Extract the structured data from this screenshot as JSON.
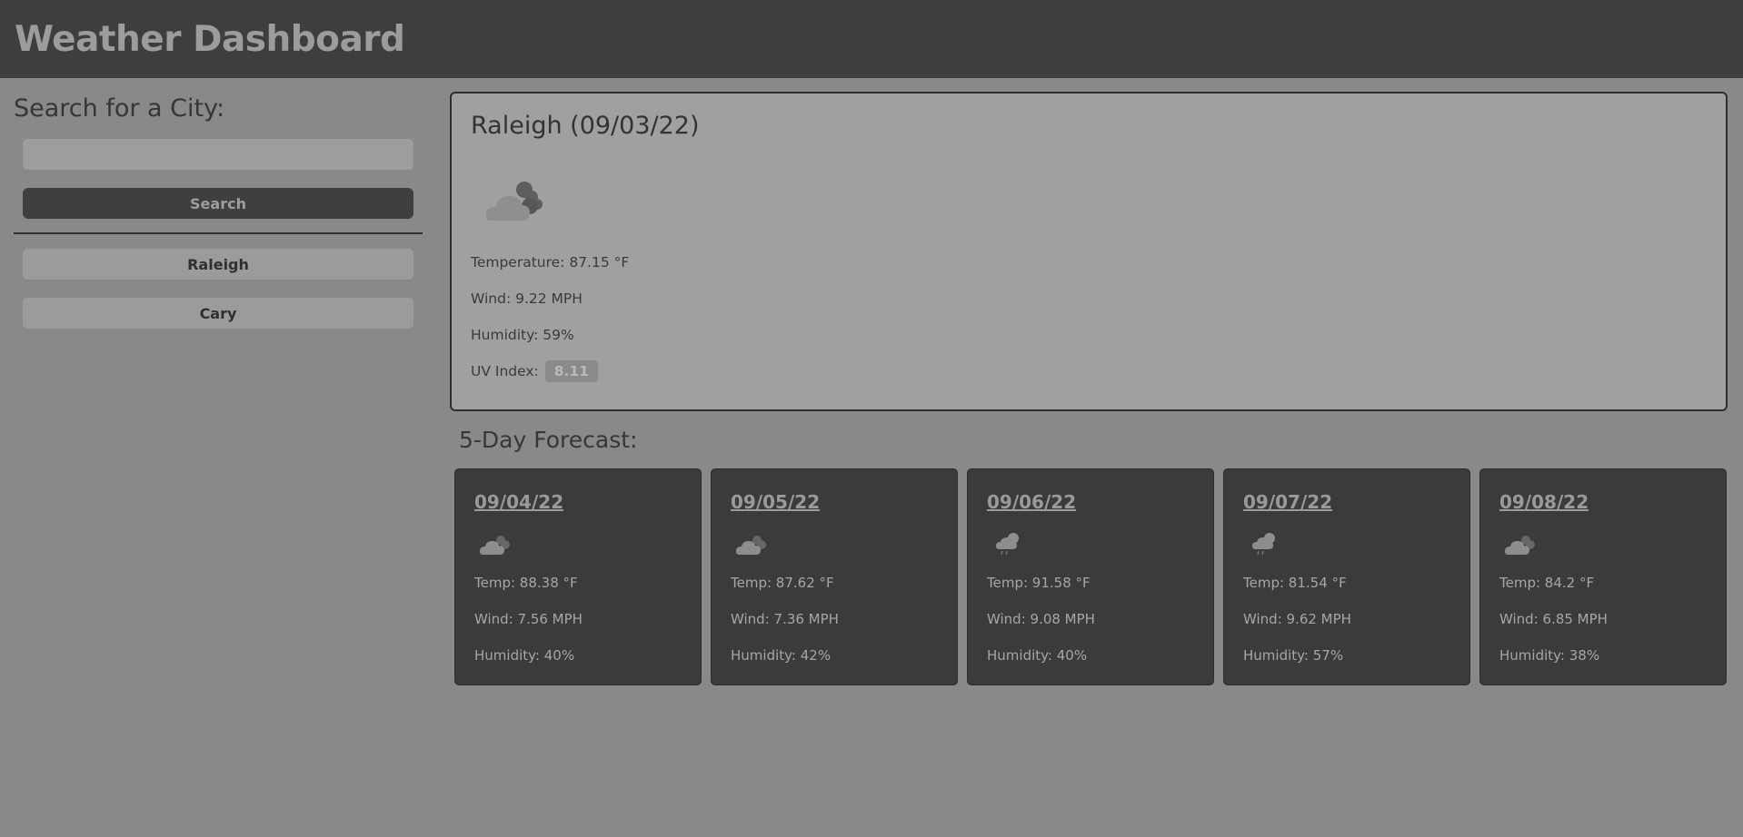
{
  "header": {
    "title": "Weather Dashboard"
  },
  "sidebar": {
    "heading": "Search for a City:",
    "search_value": "",
    "search_placeholder": "",
    "search_button": "Search",
    "history": [
      "Raleigh",
      "Cary"
    ]
  },
  "current": {
    "title": "Raleigh (09/03/22)",
    "icon": "clouds-icon",
    "temperature": "Temperature: 87.15 °F",
    "wind": "Wind: 9.22 MPH",
    "humidity": "Humidity: 59%",
    "uv_label": "UV Index:",
    "uv_value": "8.11"
  },
  "forecast": {
    "heading": "5-Day Forecast:",
    "days": [
      {
        "date": "09/04/22",
        "icon": "clouds-icon",
        "temp": "Temp: 88.38 °F",
        "wind": "Wind: 7.56 MPH",
        "humidity": "Humidity: 40%"
      },
      {
        "date": "09/05/22",
        "icon": "clouds-icon",
        "temp": "Temp: 87.62 °F",
        "wind": "Wind: 7.36 MPH",
        "humidity": "Humidity: 42%"
      },
      {
        "date": "09/06/22",
        "icon": "rain-icon",
        "temp": "Temp: 91.58 °F",
        "wind": "Wind: 9.08 MPH",
        "humidity": "Humidity: 40%"
      },
      {
        "date": "09/07/22",
        "icon": "rain-icon",
        "temp": "Temp: 81.54 °F",
        "wind": "Wind: 9.62 MPH",
        "humidity": "Humidity: 57%"
      },
      {
        "date": "09/08/22",
        "icon": "clouds-icon",
        "temp": "Temp: 84.2 °F",
        "wind": "Wind: 6.85 MPH",
        "humidity": "Humidity: 38%"
      }
    ]
  },
  "colors": {
    "page_background": "#898989",
    "header_background": "#3e3e3e",
    "card_background": "#3b3b3b",
    "current_background": "#a0a0a0"
  }
}
